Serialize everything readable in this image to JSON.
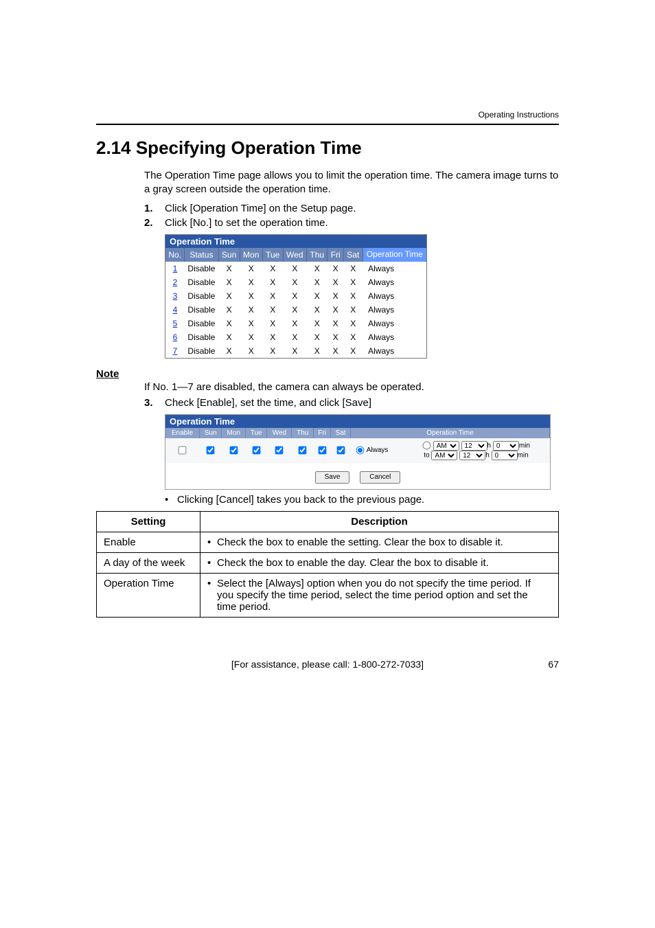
{
  "running_head": "Operating Instructions",
  "section_number": "2.14",
  "section_title": "Specifying Operation Time",
  "intro": "The Operation Time page allows you to limit the operation time. The camera image turns to a gray screen outside the operation time.",
  "steps": {
    "s1": {
      "num": "1.",
      "text": "Click [Operation Time] on the Setup page."
    },
    "s2": {
      "num": "2.",
      "text": "Click [No.] to set the operation time."
    },
    "s3": {
      "num": "3.",
      "text": "Check [Enable], set the time, and click [Save]"
    }
  },
  "note_heading": "Note",
  "note_body": "If No. 1—7 are disabled, the camera can always be operated.",
  "cancel_note": "Clicking [Cancel] takes you back to the previous page.",
  "shot1": {
    "title": "Operation Time",
    "headers": {
      "no": "No.",
      "status": "Status",
      "sun": "Sun",
      "mon": "Mon",
      "tue": "Tue",
      "wed": "Wed",
      "thu": "Thu",
      "fri": "Fri",
      "sat": "Sat",
      "ot": "Operation Time"
    },
    "rows": [
      {
        "no": "1",
        "status": "Disable",
        "ot": "Always"
      },
      {
        "no": "2",
        "status": "Disable",
        "ot": "Always"
      },
      {
        "no": "3",
        "status": "Disable",
        "ot": "Always"
      },
      {
        "no": "4",
        "status": "Disable",
        "ot": "Always"
      },
      {
        "no": "5",
        "status": "Disable",
        "ot": "Always"
      },
      {
        "no": "6",
        "status": "Disable",
        "ot": "Always"
      },
      {
        "no": "7",
        "status": "Disable",
        "ot": "Always"
      }
    ],
    "x": "X"
  },
  "shot2": {
    "title": "Operation Time",
    "headers": {
      "enable": "Enable",
      "sun": "Sun",
      "mon": "Mon",
      "tue": "Tue",
      "wed": "Wed",
      "thu": "Thu",
      "fri": "Fri",
      "sat": "Sat",
      "ot": "Operation Time"
    },
    "always_label": "Always",
    "ampm": "AM",
    "hour": "12",
    "h_label": "h",
    "min_sel": "0",
    "min_label": "min",
    "to_label": "to",
    "save": "Save",
    "cancel": "Cancel"
  },
  "settings_table": {
    "h_setting": "Setting",
    "h_desc": "Description",
    "rows": {
      "enable": {
        "label": "Enable",
        "desc": "Check the box to enable the setting. Clear the box to disable it."
      },
      "day": {
        "label": "A day of the week",
        "desc": "Check the box to enable the day. Clear the box to disable it."
      },
      "ot": {
        "label": "Operation Time",
        "desc": "Select the [Always] option when you do not specify the time period. If you specify the time period, select the time period option and set the time period."
      }
    }
  },
  "footer": {
    "assist": "[For assistance, please call: 1-800-272-7033]",
    "page": "67"
  }
}
